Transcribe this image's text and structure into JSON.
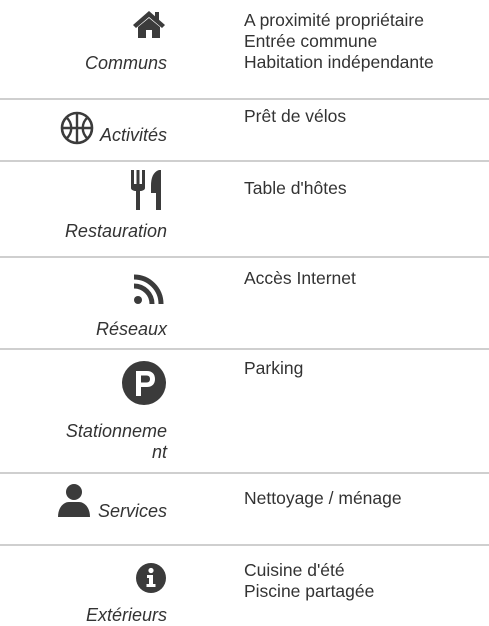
{
  "rows": [
    {
      "category": "Communs",
      "icon": "home-icon",
      "features": [
        "A proximité propriétaire",
        "Entrée commune",
        "Habitation indépendante"
      ]
    },
    {
      "category": "Activités",
      "icon": "basketball-icon",
      "features": [
        "Prêt de vélos"
      ]
    },
    {
      "category": "Restauration",
      "icon": "utensils-icon",
      "features": [
        "Table d'hôtes"
      ]
    },
    {
      "category": "Réseaux",
      "icon": "rss-icon",
      "features": [
        "Accès Internet"
      ]
    },
    {
      "category": "Stationneme nt",
      "icon": "parking-icon",
      "features": [
        "Parking"
      ]
    },
    {
      "category": "Services",
      "icon": "user-icon",
      "features": [
        "Nettoyage / ménage"
      ]
    },
    {
      "category": "Extérieurs",
      "icon": "info-circle-icon",
      "features": [
        "Cuisine d'été",
        "Piscine partagée"
      ]
    }
  ],
  "colors": {
    "text": "#333333",
    "icon": "#3b3b3b",
    "divider": "#cfcfcf"
  }
}
